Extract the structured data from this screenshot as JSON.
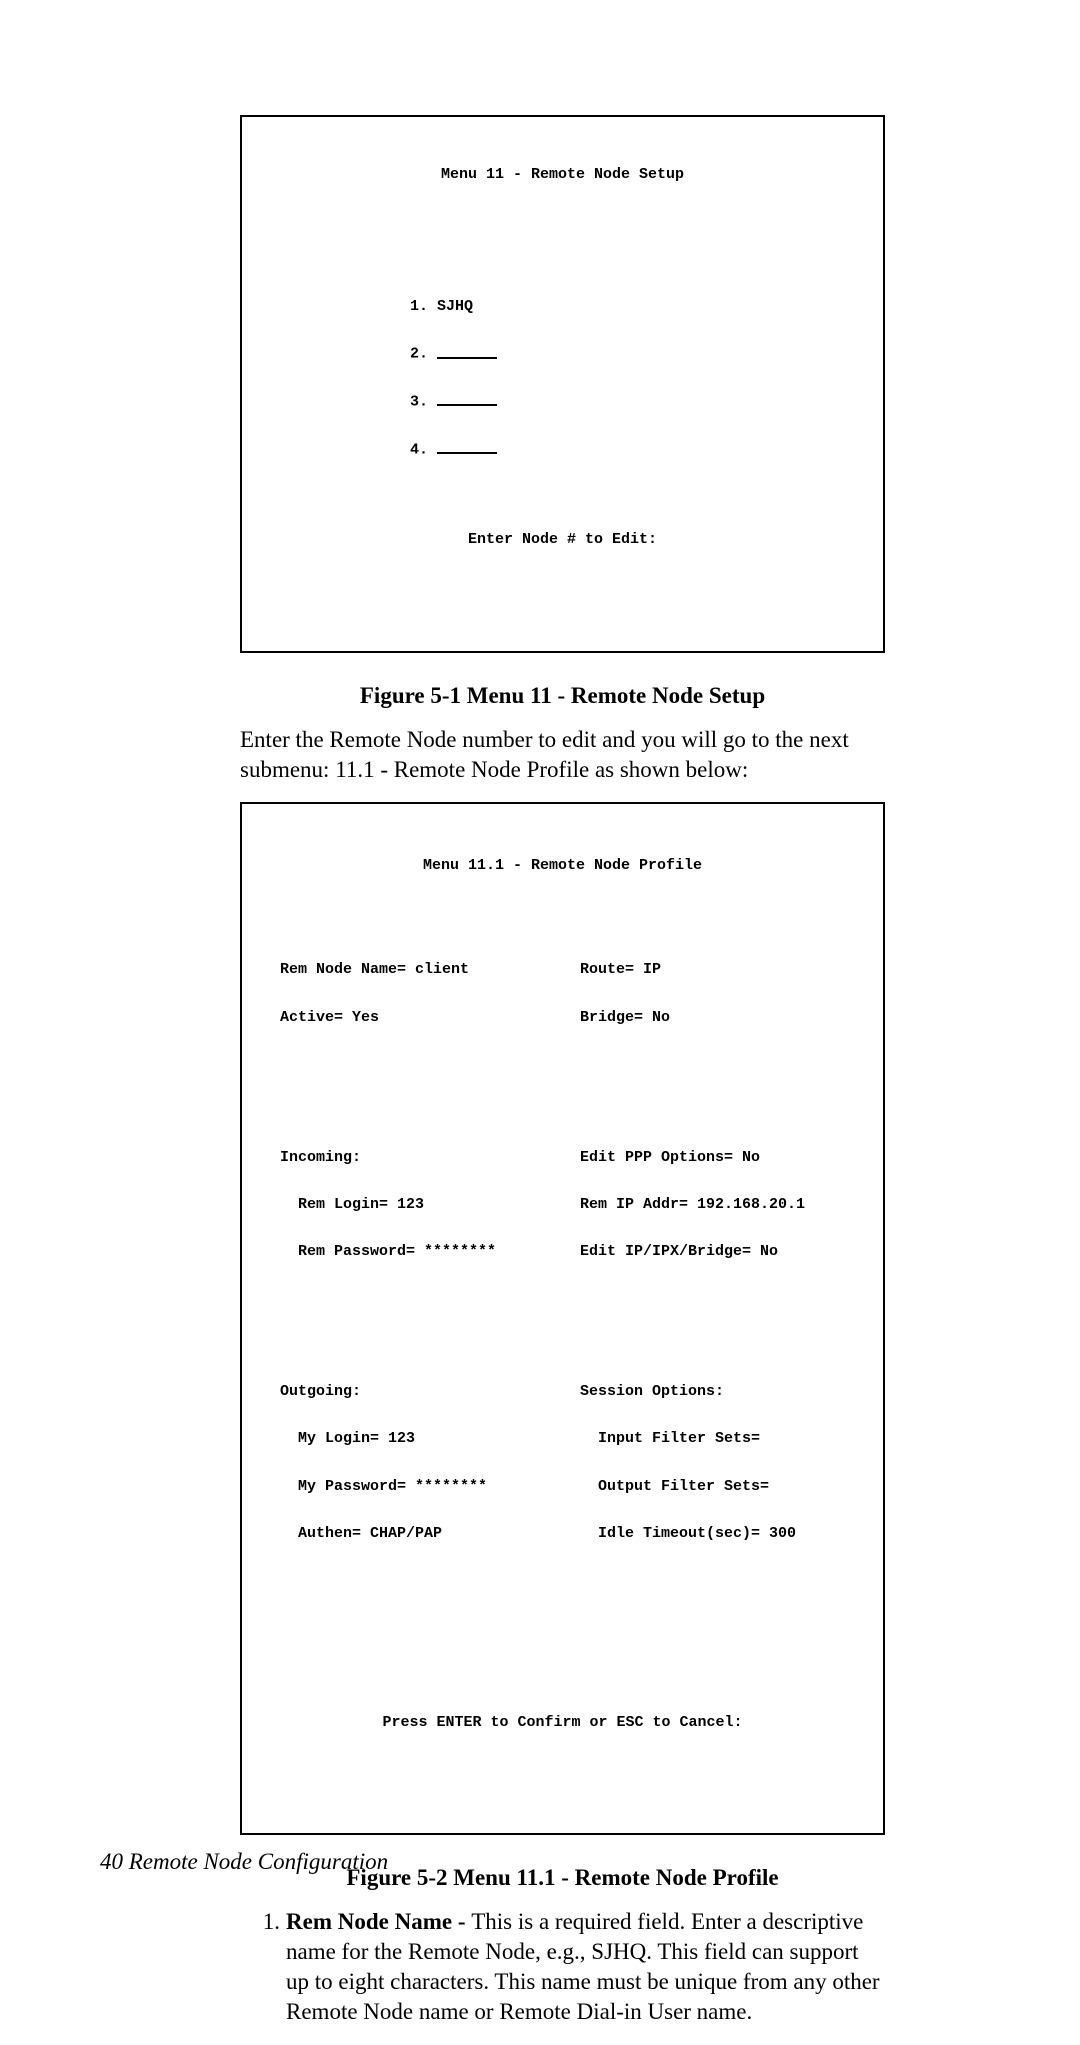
{
  "figure1": {
    "title": "Menu 11 - Remote Node Setup",
    "node1": "SJHQ",
    "prompt": "Enter Node # to Edit:",
    "caption": "Figure 5-1 Menu 11 - Remote Node Setup"
  },
  "para1": "Enter the Remote Node number to edit and you will go to the next submenu: 11.1 - Remote Node Profile as shown below:",
  "figure2": {
    "title": "Menu 11.1 - Remote Node Profile",
    "left": {
      "rem_node_name": "Rem Node Name= client",
      "active": "Active= Yes",
      "incoming_hdr": "Incoming:",
      "rem_login": "Rem Login= 123",
      "rem_password": "Rem Password= ********",
      "outgoing_hdr": "Outgoing:",
      "my_login": "My Login= 123",
      "my_password": "My Password= ********",
      "authen": "Authen= CHAP/PAP"
    },
    "right": {
      "route": "Route= IP",
      "bridge": "Bridge= No",
      "edit_ppp": "Edit PPP Options= No",
      "rem_ip": "Rem IP Addr= 192.168.20.1",
      "edit_ipx": "Edit IP/IPX/Bridge= No",
      "session_hdr": "Session Options:",
      "input_filter": "Input Filter Sets=",
      "output_filter": "Output Filter Sets=",
      "idle_timeout": "Idle Timeout(sec)= 300"
    },
    "confirm": "Press ENTER to Confirm or ESC to Cancel:",
    "caption": "Figure 5-2 Menu 11.1 - Remote Node Profile"
  },
  "list1": {
    "num": "1.",
    "label": "Rem Node Name - ",
    "text": "This is a required field. Enter a descriptive name for the Remote Node, e.g., SJHQ. This field can support up to eight characters. This name must be unique from any other Remote Node name or Remote Dial-in User name."
  },
  "footer": "40  Remote Node Configuration"
}
